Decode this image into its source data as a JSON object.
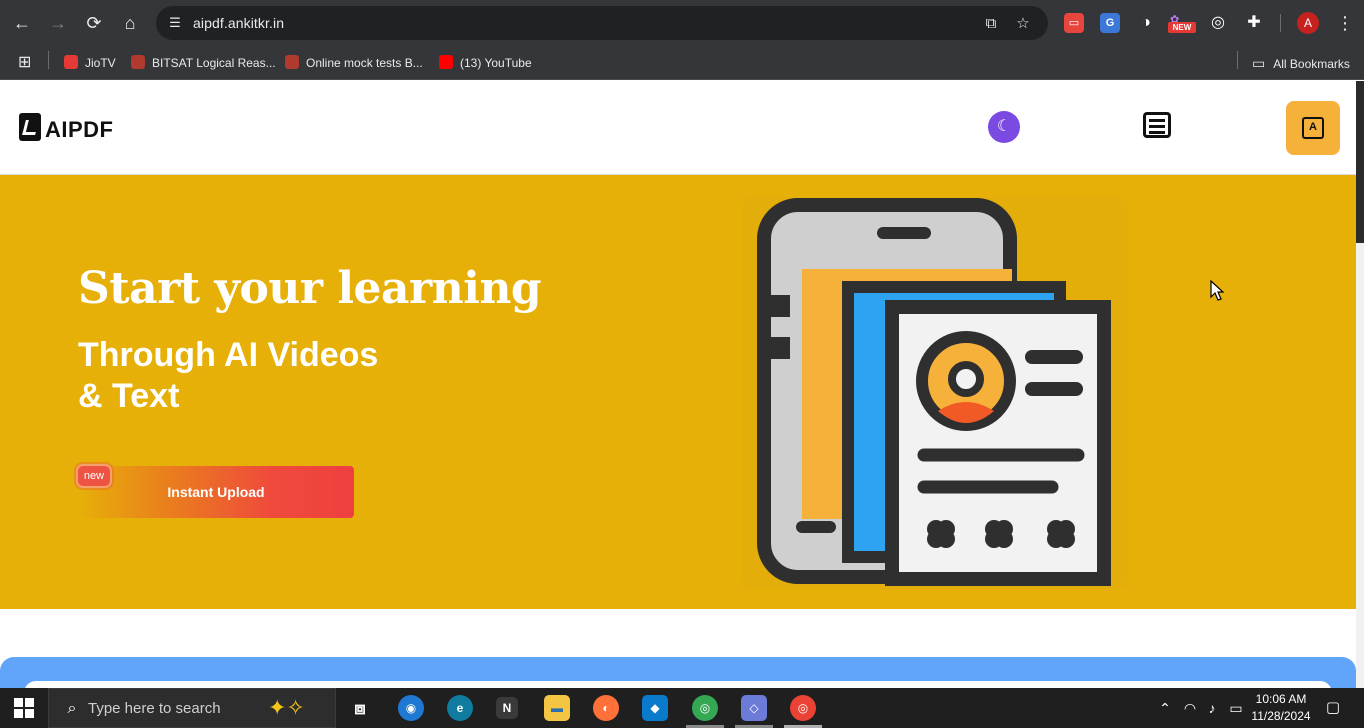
{
  "browser": {
    "url": "aipdf.ankitkr.in",
    "ext_new_badge": "NEW",
    "profile_initial": "A",
    "bookmarks": [
      {
        "label": "JioTV",
        "color": "#e53935"
      },
      {
        "label": "BITSAT Logical Reas...",
        "color": "#c0392b"
      },
      {
        "label": "Online mock tests B...",
        "color": "#c0392b"
      },
      {
        "label": "(13) YouTube",
        "color": "#ff0000"
      }
    ],
    "all_bookmarks": "All Bookmarks"
  },
  "site": {
    "logo_text": "AIPDF",
    "lang_glyph": "A",
    "hero": {
      "title": "Start your learning",
      "subtitle_line1": "Through AI Videos",
      "subtitle_line2": "& Text",
      "upload_button": "Instant Upload",
      "new_badge": "new"
    }
  },
  "taskbar": {
    "search_placeholder": "Type here to search",
    "time": "10:06 AM",
    "date": "11/28/2024",
    "apps": [
      {
        "name": "photos",
        "glyph": "◉",
        "color": "#1f78d1"
      },
      {
        "name": "edge",
        "glyph": "e",
        "color": "#0f7b9e"
      },
      {
        "name": "notion",
        "glyph": "N",
        "color": "#3a3a3a"
      },
      {
        "name": "file-explorer",
        "glyph": "▬",
        "color": "#f4c542"
      },
      {
        "name": "firefox",
        "glyph": "◐",
        "color": "#ff7139"
      },
      {
        "name": "vscode",
        "glyph": "◆",
        "color": "#0a7acc"
      },
      {
        "name": "chrome-a",
        "glyph": "◎",
        "color": "#34a853"
      },
      {
        "name": "git-tool",
        "glyph": "◇",
        "color": "#6c7bd8"
      },
      {
        "name": "chrome-b",
        "glyph": "◎",
        "color": "#ea4335"
      }
    ]
  },
  "colors": {
    "hero_bg": "#e6b008",
    "accent_orange": "#f6b13a",
    "theme_purple": "#7b4ae2",
    "blue_section": "#60a5fa"
  }
}
